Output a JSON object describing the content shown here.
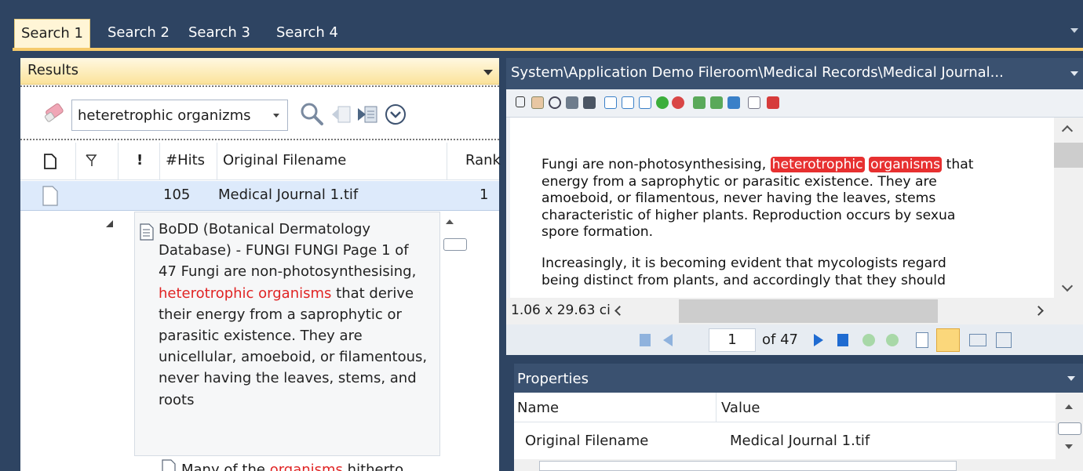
{
  "tabs": [
    "Search 1",
    "Search 2",
    "Search 3",
    "Search 4"
  ],
  "results": {
    "title": "Results",
    "search_value": "heteretrophic organizms",
    "columns": [
      "#Hits",
      "Original Filename",
      "Rank"
    ],
    "rows": [
      {
        "hits": "105",
        "filename": "Medical Journal 1.tif",
        "rank": "1"
      }
    ],
    "snippet": {
      "part1": "BoDD (Botanical Dermatology Database) - FUNGI FUNGI Page 1 of 47 Fungi are non-photosynthesising, ",
      "hl1": "heterotrophic organisms",
      "part2": " that derive their energy from a saprophytic or parasitic existence. They are unicellular, amoeboid, or filamentous, never having the leaves, stems, and roots"
    },
    "next_snippet": {
      "part1": "Many of the ",
      "hl1": "organisms",
      "part2": " hitherto"
    }
  },
  "viewer": {
    "title": "System\\Application Demo Fileroom\\Medical Records\\Medical Journal...",
    "doc_text": {
      "p1a": "Fungi are non-photosynthesising, ",
      "hl1": "heterotrophic",
      "hl2": "organisms",
      "p1b": " that",
      "p1c": "energy from a saprophytic or parasitic existence. They are",
      "p1d": "amoeboid, or filamentous, never having the leaves, stems",
      "p1e": "characteristic of higher plants. Reproduction occurs by sexua",
      "p1f": "spore formation.",
      "p2a": "Increasingly, it is becoming evident that mycologists regard",
      "p2b": "being distinct from plants, and accordingly that they should"
    },
    "dimensions": "1.06 x 29.63 ci",
    "page_current": "1",
    "page_total": "of 47"
  },
  "properties": {
    "title": "Properties",
    "col_name": "Name",
    "col_value": "Value",
    "rows": [
      {
        "name": "Original Filename",
        "value": "Medical Journal 1.tif"
      }
    ]
  },
  "colors": {
    "frame": "#2e4462",
    "accent": "#f5ca6c",
    "highlight": "#e73030",
    "selected_row": "#ddeafb"
  }
}
